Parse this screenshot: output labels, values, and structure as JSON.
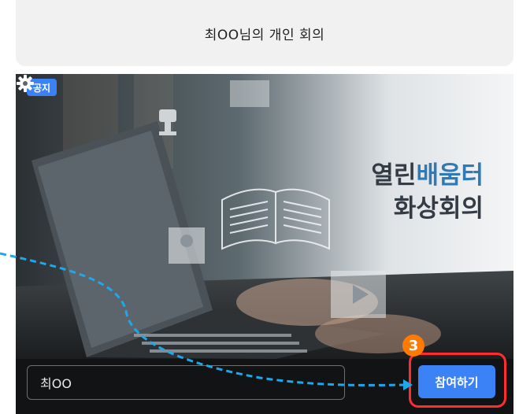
{
  "header": {
    "title": "최OO님의 개인 회의"
  },
  "banner": {
    "notice_badge": "공지",
    "title_line1_part1": "열린",
    "title_line1_part2": "배움터",
    "title_line2": "화상회의"
  },
  "join": {
    "name_value": "최OO",
    "button_label": "참여하기"
  },
  "annotation": {
    "step_number": "3"
  },
  "colors": {
    "accent_blue": "#3b82f6",
    "highlight_red": "#ff2d2d",
    "step_orange": "#ff7a00",
    "guide_arrow": "#1ea7ea"
  },
  "icons": {
    "settings": "gear-icon"
  }
}
